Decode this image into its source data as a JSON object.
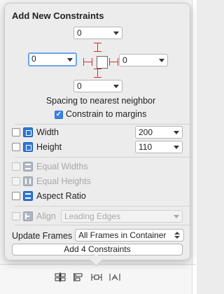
{
  "popover": {
    "title": "Add New Constraints",
    "spacing": {
      "top": "0",
      "left": "0",
      "right": "0",
      "bottom": "0",
      "caption": "Spacing to nearest neighbor",
      "constrain_label": "Constrain to margins",
      "constrain_checked": true
    },
    "size": {
      "width_label": "Width",
      "width_value": "200",
      "height_label": "Height",
      "height_value": "110"
    },
    "equal": {
      "widths_label": "Equal Widths",
      "heights_label": "Equal Heights",
      "aspect_label": "Aspect Ratio"
    },
    "align": {
      "label": "Align",
      "value": "Leading Edges"
    },
    "update_frames": {
      "label": "Update Frames",
      "value": "All Frames in Container"
    },
    "add_button": "Add 4 Constraints"
  },
  "colors": {
    "accent": "#3b82e6",
    "constraint_red": "#d13030",
    "focus_ring": "#6ba5ea"
  },
  "toolbar": {
    "icons": [
      "align-icon",
      "pin-icon",
      "resolve-issues-icon",
      "resizing-icon"
    ]
  }
}
